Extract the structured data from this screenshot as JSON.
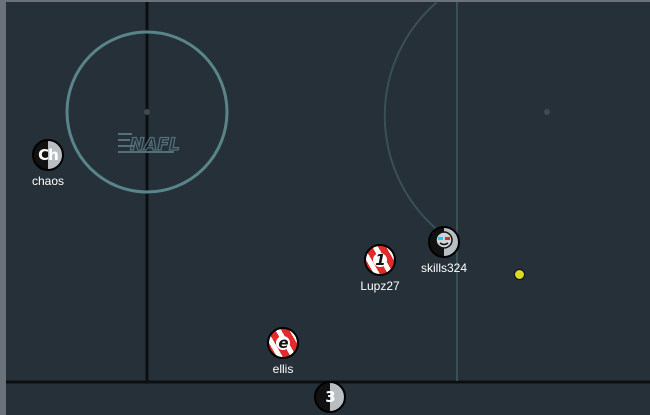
{
  "field": {
    "logo_text": "NAFL"
  },
  "players": [
    {
      "id": "chaos",
      "avatar": "Ch",
      "name": "chaos",
      "kit": "gray"
    },
    {
      "id": "skills324",
      "avatar": "",
      "name": "skills324",
      "kit": "gray"
    },
    {
      "id": "lupz27",
      "avatar": "1",
      "name": "Lupz27",
      "kit": "red"
    },
    {
      "id": "ellis",
      "avatar": "e",
      "name": "ellis",
      "kit": "red"
    },
    {
      "id": "unnamed",
      "avatar": "3",
      "name": "",
      "kit": "gray"
    }
  ],
  "colors": {
    "pitch": "#253038",
    "outside": "#6b7279",
    "red_team": "#e12b2b",
    "ball": "#d7dc1c"
  }
}
